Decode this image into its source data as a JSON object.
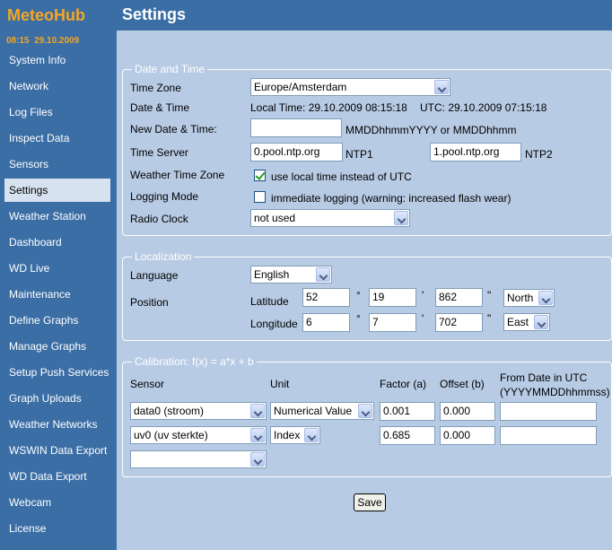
{
  "brand": "MeteoHub",
  "datetime": "08:15  29.10.2009",
  "page_title": "Settings",
  "nav": [
    {
      "label": "System Info"
    },
    {
      "label": "Network"
    },
    {
      "label": "Log Files"
    },
    {
      "label": "Inspect Data"
    },
    {
      "label": "Sensors"
    },
    {
      "label": "Settings",
      "active": true
    },
    {
      "label": "Weather Station"
    },
    {
      "label": "Dashboard"
    },
    {
      "label": "WD Live"
    },
    {
      "label": "Maintenance"
    },
    {
      "label": "Define Graphs"
    },
    {
      "label": "Manage Graphs"
    },
    {
      "label": "Setup Push Services"
    },
    {
      "label": "Graph Uploads"
    },
    {
      "label": "Weather Networks"
    },
    {
      "label": "WSWIN Data Export"
    },
    {
      "label": "WD Data Export"
    },
    {
      "label": "Webcam"
    },
    {
      "label": "License"
    }
  ],
  "date_time": {
    "legend": "Date and Time",
    "time_zone_label": "Time Zone",
    "time_zone_value": "Europe/Amsterdam",
    "date_time_label": "Date & Time",
    "local_time_text": "Local Time: 29.10.2009 08:15:18",
    "utc_text": "UTC: 29.10.2009 07:15:18",
    "new_date_label": "New Date & Time:",
    "new_date_value": "",
    "new_date_hint": "MMDDhhmmYYYY or MMDDhhmm",
    "time_server_label": "Time Server",
    "ntp1_value": "0.pool.ntp.org",
    "ntp1_label": "NTP1",
    "ntp2_value": "1.pool.ntp.org",
    "ntp2_label": "NTP2",
    "weather_tz_label": "Weather Time Zone",
    "weather_tz_checked": true,
    "weather_tz_text": "use local time instead of UTC",
    "logging_label": "Logging Mode",
    "logging_checked": false,
    "logging_text": "immediate logging (warning: increased flash wear)",
    "radio_clock_label": "Radio Clock",
    "radio_clock_value": "not used"
  },
  "localization": {
    "legend": "Localization",
    "language_label": "Language",
    "language_value": "English",
    "position_label": "Position",
    "latitude_label": "Latitude",
    "lat_deg": "52",
    "lat_min": "19",
    "lat_sec": "862",
    "lat_dir": "North",
    "longitude_label": "Longitude",
    "lon_deg": "6",
    "lon_min": "7",
    "lon_sec": "702",
    "lon_dir": "East",
    "deg_symbol": "°",
    "min_symbol": "'",
    "sec_symbol": "\""
  },
  "calibration": {
    "legend": "Calibration: f(x) = a*x + b",
    "col_sensor": "Sensor",
    "col_unit": "Unit",
    "col_factor": "Factor (a)",
    "col_offset": "Offset (b)",
    "col_from_date": "From Date in UTC",
    "col_from_date_sub": "(YYYYMMDDhhmmss)",
    "rows": [
      {
        "sensor": "data0 (stroom)",
        "unit": "Numerical Value",
        "factor": "0.001",
        "offset": "0.000",
        "from_date": ""
      },
      {
        "sensor": "uv0 (uv sterkte)",
        "unit": "Index",
        "factor": "0.685",
        "offset": "0.000",
        "from_date": ""
      },
      {
        "sensor": ""
      }
    ]
  },
  "save_label": "Save"
}
